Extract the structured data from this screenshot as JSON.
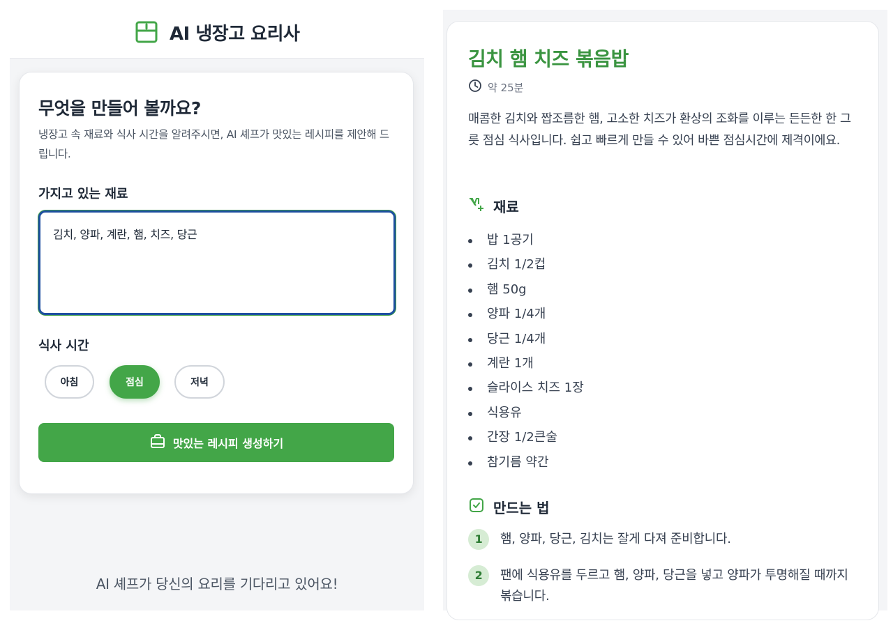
{
  "app": {
    "title": "AI 냉장고 요리사",
    "logo_icon": "fridge-icon",
    "brand_color": "#43a648"
  },
  "form": {
    "title": "무엇을 만들어 볼까요?",
    "description": "냉장고 속 재료와 식사 시간을 알려주시면, AI 셰프가 맛있는 레시피를 제안해 드립니다.",
    "ingredients_label": "가지고 있는 재료",
    "ingredients_value": "김치, 양파, 계란, 햄, 치즈, 당근",
    "meal_time_label": "식사 시간",
    "meal_options": [
      {
        "label": "아침",
        "selected": false
      },
      {
        "label": "점심",
        "selected": true
      },
      {
        "label": "저녁",
        "selected": false
      }
    ],
    "generate_button_label": "맛있는 레시피 생성하기",
    "generate_button_icon": "shopping-bag-icon",
    "waiting_message": "AI 셰프가 당신의 요리를 기다리고 있어요!"
  },
  "recipe": {
    "title": "김치 햄 치즈 볶음밥",
    "time_icon": "clock-icon",
    "time": "약 25분",
    "description": "매콤한 김치와 짭조름한 햄, 고소한 치즈가 환상의 조화를 이루는 든든한 한 그릇 점심 식사입니다. 쉽고 빠르게 만들 수 있어 바쁜 점심시간에 제격이에요.",
    "ingredients_heading": "재료",
    "ingredients_icon": "ingredients-icon",
    "ingredients": [
      "밥 1공기",
      "김치 1/2컵",
      "햄 50g",
      "양파 1/4개",
      "당근 1/4개",
      "계란 1개",
      "슬라이스 치즈 1장",
      "식용유",
      "간장 1/2큰술",
      "참기름 약간"
    ],
    "steps_heading": "만드는 법",
    "steps_icon": "check-square-icon",
    "steps": [
      {
        "num": "1",
        "text": "햄, 양파, 당근, 김치는 잘게 다져 준비합니다."
      },
      {
        "num": "2",
        "text": "팬에 식용유를 두르고 햄, 양파, 당근을 넣고 양파가 투명해질 때까지 볶습니다."
      }
    ]
  }
}
